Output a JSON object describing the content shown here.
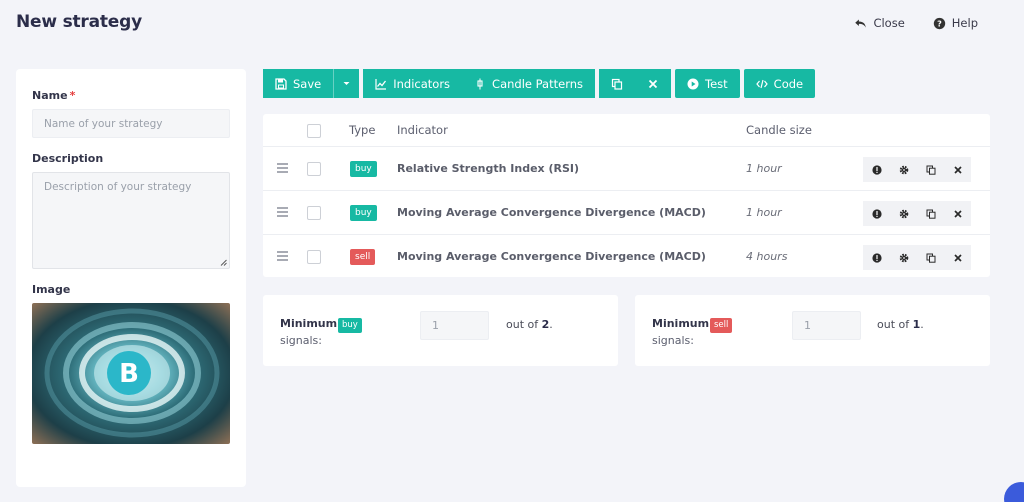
{
  "page": {
    "title": "New strategy",
    "close_label": "Close",
    "help_label": "Help"
  },
  "form": {
    "name_label": "Name",
    "required_mark": "*",
    "name_placeholder": "Name of your strategy",
    "description_label": "Description",
    "description_placeholder": "Description of your strategy",
    "image_label": "Image"
  },
  "toolbar": {
    "save_label": "Save",
    "indicators_label": "Indicators",
    "candle_patterns_label": "Candle Patterns",
    "test_label": "Test",
    "code_label": "Code"
  },
  "table": {
    "headers": {
      "type": "Type",
      "indicator": "Indicator",
      "candle_size": "Candle size"
    },
    "rows": [
      {
        "type": "buy",
        "indicator": "Relative Strength Index (RSI)",
        "candle_size": "1 hour"
      },
      {
        "type": "buy",
        "indicator": "Moving Average Convergence Divergence (MACD)",
        "candle_size": "1 hour"
      },
      {
        "type": "sell",
        "indicator": "Moving Average Convergence Divergence (MACD)",
        "candle_size": "4 hours"
      }
    ]
  },
  "signals": {
    "buy": {
      "minimum_label": "Minimum",
      "badge": "buy",
      "signals_label": "signals:",
      "value": "1",
      "out_of_label": "out of",
      "total": "2",
      "period": "."
    },
    "sell": {
      "minimum_label": "Minimum",
      "badge": "sell",
      "signals_label": "signals:",
      "value": "1",
      "out_of_label": "out of",
      "total": "1",
      "period": "."
    }
  },
  "colors": {
    "accent": "#17b9a3",
    "sell": "#e45a5a",
    "background": "#f3f4f9",
    "title": "#2b2d4a"
  },
  "icons": [
    "undo-icon",
    "help-circle-icon",
    "save-icon",
    "caret-down-icon",
    "chart-line-icon",
    "candle-icon",
    "copy-icon",
    "close-icon",
    "play-icon",
    "code-icon",
    "drag-handle-icon",
    "info-icon",
    "gear-icon"
  ]
}
